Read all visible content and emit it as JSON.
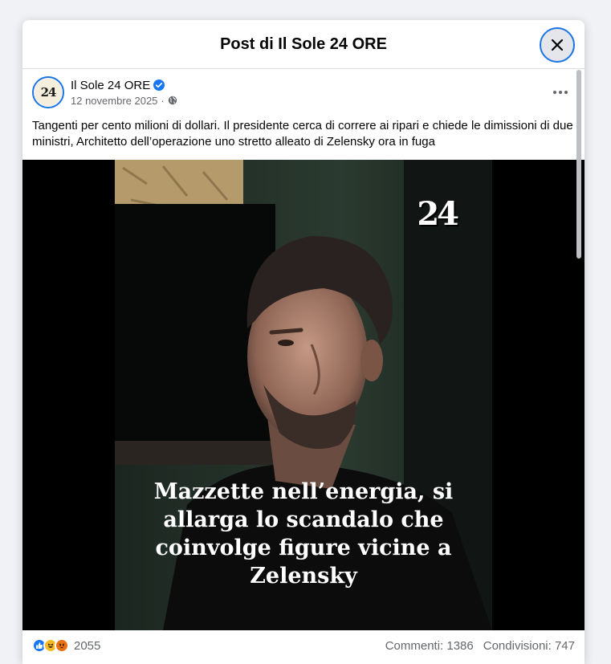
{
  "modal": {
    "title": "Post di Il Sole 24 ORE"
  },
  "post": {
    "author": "Il Sole 24 ORE",
    "avatar_text": "24",
    "date": "12 novembre 2025",
    "separator": "·",
    "text": "Tangenti per cento milioni di dollari. Il presidente cerca di correre ai ripari e chiede le dimissioni di due ministri, Architetto dell’operazione uno stretto alleato di Zelensky ora in fuga",
    "video": {
      "logo": "24",
      "caption": "Mazzette nell’energia, si allarga lo scandalo che coinvolge figure vicine a Zelensky"
    }
  },
  "engagement": {
    "reactions_count": "2055",
    "comments": "Commenti: 1386",
    "shares": "Condivisioni: 747"
  },
  "icons": {
    "close": "close-icon",
    "verified": "verified-badge-icon",
    "privacy": "globe-icon",
    "more": "more-options-icon",
    "reactions": [
      "like-icon",
      "haha-icon",
      "angry-icon"
    ]
  },
  "colors": {
    "accent": "#1877f2",
    "background": "#f0f2f5",
    "secondary_text": "#65676b"
  }
}
